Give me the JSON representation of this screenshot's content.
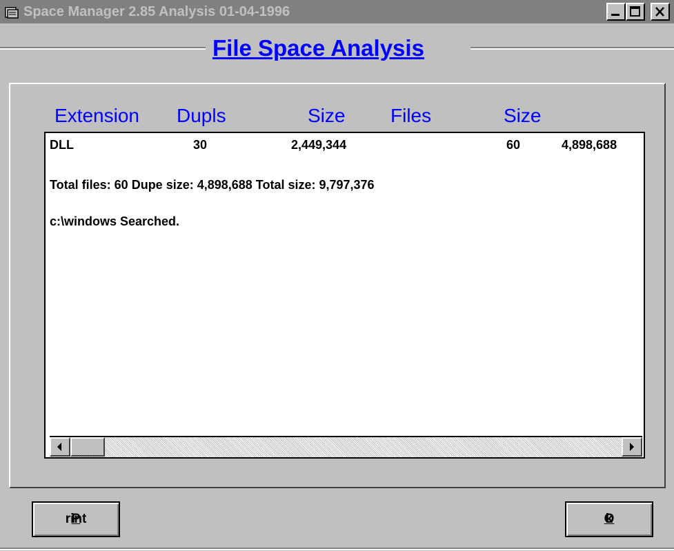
{
  "window": {
    "title": "Space Manager 2.85 Analysis 01-04-1996",
    "icon": "document-icon",
    "controls": [
      "minimize",
      "maximize",
      "close"
    ]
  },
  "heading": "File Space Analysis",
  "columns": {
    "extension": "Extension",
    "dupls": "Dupls",
    "size1": "Size",
    "files": "Files",
    "size2": "Size"
  },
  "results": {
    "row": {
      "extension": "DLL",
      "dupls": "30",
      "size1": "2,449,344",
      "files": "60",
      "size2": "4,898,688"
    },
    "total_line": "Total files: 60  Dupe size: 4,898,688   Total size: 9,797,376",
    "searched_line": "c:\\windows Searched."
  },
  "buttons": {
    "print_label_accel": "P",
    "print_label_rest": "rint",
    "ok_label_accel": "O",
    "ok_label_rest": "k"
  },
  "colors": {
    "heading": "#0000ff",
    "column_headers": "#0000ff",
    "face": "#c0c0c0",
    "titlebar_inactive": "#808080"
  }
}
